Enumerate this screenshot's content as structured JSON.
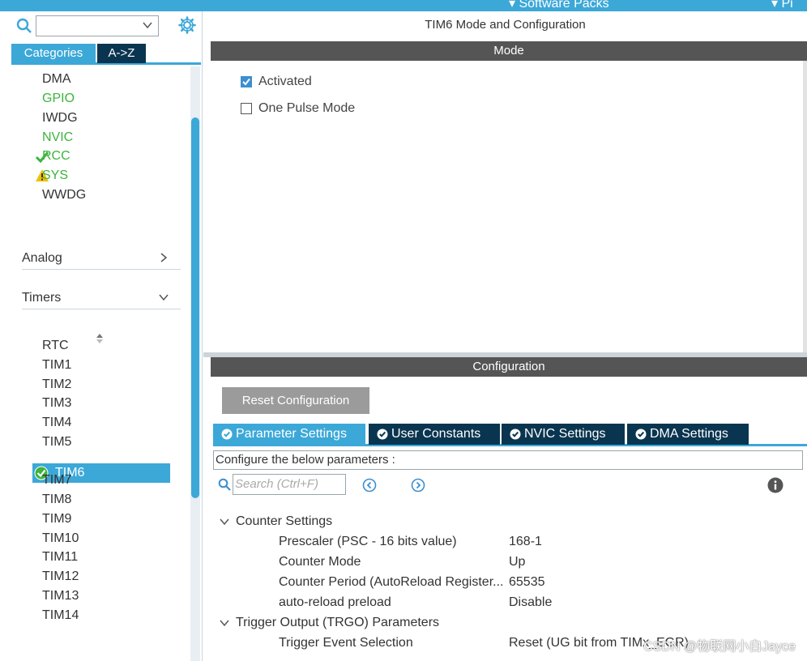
{
  "topbar": {
    "left_text": "▾ Software Packs",
    "right_text": "▾ Pi"
  },
  "left_panel": {
    "search_value": "",
    "tabs": [
      {
        "label": "Categories"
      },
      {
        "label": "A->Z"
      }
    ],
    "system_items": [
      {
        "label": "DMA",
        "status": "none"
      },
      {
        "label": "GPIO",
        "status": "green"
      },
      {
        "label": "IWDG",
        "status": "none"
      },
      {
        "label": "NVIC",
        "status": "green"
      },
      {
        "label": "RCC",
        "status": "check"
      },
      {
        "label": "SYS",
        "status": "warning"
      },
      {
        "label": "WWDG",
        "status": "none"
      }
    ],
    "sections": [
      {
        "label": "Analog"
      },
      {
        "label": "Timers"
      }
    ],
    "timer_items": [
      "RTC",
      "TIM1",
      "TIM2",
      "TIM3",
      "TIM4",
      "TIM5",
      "TIM6",
      "TIM7",
      "TIM8",
      "TIM9",
      "TIM10",
      "TIM11",
      "TIM12",
      "TIM13",
      "TIM14"
    ],
    "selected_timer": "TIM6"
  },
  "main": {
    "title": "TIM6 Mode and Configuration",
    "mode": {
      "header": "Mode",
      "options": [
        {
          "label": "Activated",
          "checked": true
        },
        {
          "label": "One Pulse Mode",
          "checked": false
        }
      ]
    },
    "configuration": {
      "header": "Configuration",
      "reset_label": "Reset Configuration",
      "tabs": [
        {
          "label": "Parameter Settings",
          "active": true
        },
        {
          "label": "User Constants",
          "active": false
        },
        {
          "label": "NVIC Settings",
          "active": false
        },
        {
          "label": "DMA Settings",
          "active": false
        }
      ],
      "configure_text": "Configure the below parameters :",
      "search_placeholder": "Search (Ctrl+F)",
      "groups": [
        {
          "label": "Counter Settings",
          "params": [
            {
              "name": "Prescaler (PSC - 16 bits value)",
              "value": "168-1"
            },
            {
              "name": "Counter Mode",
              "value": "Up"
            },
            {
              "name": "Counter Period (AutoReload Register...",
              "value": "65535"
            },
            {
              "name": "auto-reload preload",
              "value": "Disable"
            }
          ]
        },
        {
          "label": "Trigger Output (TRGO) Parameters",
          "params": [
            {
              "name": "Trigger Event Selection",
              "value": "Reset (UG bit from TIMx_EGR)"
            }
          ]
        }
      ]
    }
  },
  "watermark": "CSDN @物联网小白Jayce",
  "colors": {
    "accent": "#3ca8d8",
    "dark_tab": "#0a3550",
    "green": "#3cb43c",
    "warning": "#f0c000",
    "header": "#555555"
  }
}
